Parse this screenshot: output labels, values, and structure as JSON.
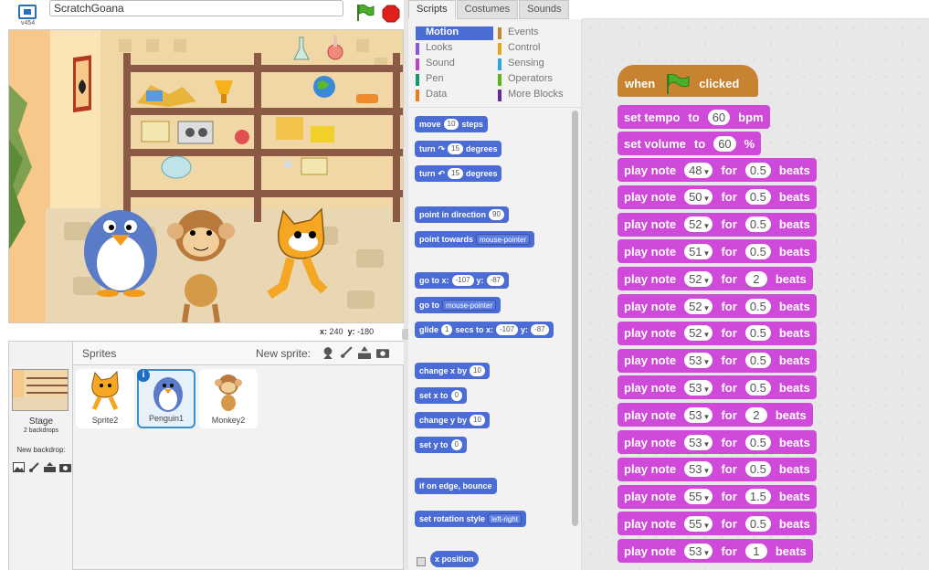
{
  "topbar": {
    "version": "v454",
    "project_title": "ScratchGoana"
  },
  "stage": {
    "coords": {
      "x_label": "x:",
      "x": "240",
      "y_label": "y:",
      "y": "-180"
    }
  },
  "sprite_pane": {
    "title": "Sprites",
    "new_sprite_label": "New sprite:",
    "stage_label": "Stage",
    "backdrops_count": "2 backdrops",
    "new_backdrop_label": "New backdrop:",
    "sprites": [
      {
        "name": "Sprite2",
        "selected": false
      },
      {
        "name": "Penguin1",
        "selected": true
      },
      {
        "name": "Monkey2",
        "selected": false
      }
    ]
  },
  "tabs": [
    {
      "label": "Scripts",
      "active": true
    },
    {
      "label": "Costumes",
      "active": false
    },
    {
      "label": "Sounds",
      "active": false
    }
  ],
  "categories": [
    {
      "label": "Motion",
      "color": "#4a6cd4",
      "active": true
    },
    {
      "label": "Looks",
      "color": "#8a55d7",
      "active": false
    },
    {
      "label": "Sound",
      "color": "#bb42c3",
      "active": false
    },
    {
      "label": "Pen",
      "color": "#0e9a6c",
      "active": false
    },
    {
      "label": "Data",
      "color": "#ee7d16",
      "active": false
    },
    {
      "label": "Events",
      "color": "#c88330",
      "active": false
    },
    {
      "label": "Control",
      "color": "#e1a91a",
      "active": false
    },
    {
      "label": "Sensing",
      "color": "#2ca5e2",
      "active": false
    },
    {
      "label": "Operators",
      "color": "#5cb712",
      "active": false
    },
    {
      "label": "More Blocks",
      "color": "#632d99",
      "active": false
    }
  ],
  "palette_blocks": {
    "move": {
      "a": "move",
      "n": "10",
      "b": "steps"
    },
    "turn_cw": {
      "a": "turn",
      "n": "15",
      "b": "degrees"
    },
    "turn_ccw": {
      "a": "turn",
      "n": "15",
      "b": "degrees"
    },
    "point_dir": {
      "a": "point in direction",
      "n": "90"
    },
    "point_towards": {
      "a": "point towards",
      "d": "mouse-pointer"
    },
    "go_xy": {
      "a": "go to x:",
      "x": "-107",
      "b": "y:",
      "y": "-87"
    },
    "go_to": {
      "a": "go to",
      "d": "mouse-pointer"
    },
    "glide": {
      "a": "glide",
      "n": "1",
      "b": "secs to x:",
      "x": "-107",
      "c": "y:",
      "y": "-87"
    },
    "change_x": {
      "a": "change x by",
      "n": "10"
    },
    "set_x": {
      "a": "set x to",
      "n": "0"
    },
    "change_y": {
      "a": "change y by",
      "n": "10"
    },
    "set_y": {
      "a": "set y to",
      "n": "0"
    },
    "bounce": {
      "a": "if on edge, bounce"
    },
    "rot_style": {
      "a": "set rotation style",
      "d": "left-right"
    },
    "x_position": {
      "a": "x position"
    }
  },
  "script": {
    "hat": {
      "when": "when",
      "clicked": "clicked"
    },
    "tempo": {
      "a": "set tempo",
      "b": "to",
      "v": "60",
      "c": "bpm"
    },
    "volume": {
      "a": "set volume",
      "b": "to",
      "v": "60",
      "c": "%"
    },
    "play_label": "play note",
    "for_label": "for",
    "beats_label": "beats",
    "notes": [
      {
        "note": "48",
        "beats": "0.5"
      },
      {
        "note": "50",
        "beats": "0.5"
      },
      {
        "note": "52",
        "beats": "0.5"
      },
      {
        "note": "51",
        "beats": "0.5"
      },
      {
        "note": "52",
        "beats": "2"
      },
      {
        "note": "52",
        "beats": "0.5"
      },
      {
        "note": "52",
        "beats": "0.5"
      },
      {
        "note": "53",
        "beats": "0.5"
      },
      {
        "note": "53",
        "beats": "0.5"
      },
      {
        "note": "53",
        "beats": "2"
      },
      {
        "note": "53",
        "beats": "0.5"
      },
      {
        "note": "53",
        "beats": "0.5"
      },
      {
        "note": "55",
        "beats": "1.5"
      },
      {
        "note": "55",
        "beats": "0.5"
      },
      {
        "note": "53",
        "beats": "1"
      }
    ]
  }
}
